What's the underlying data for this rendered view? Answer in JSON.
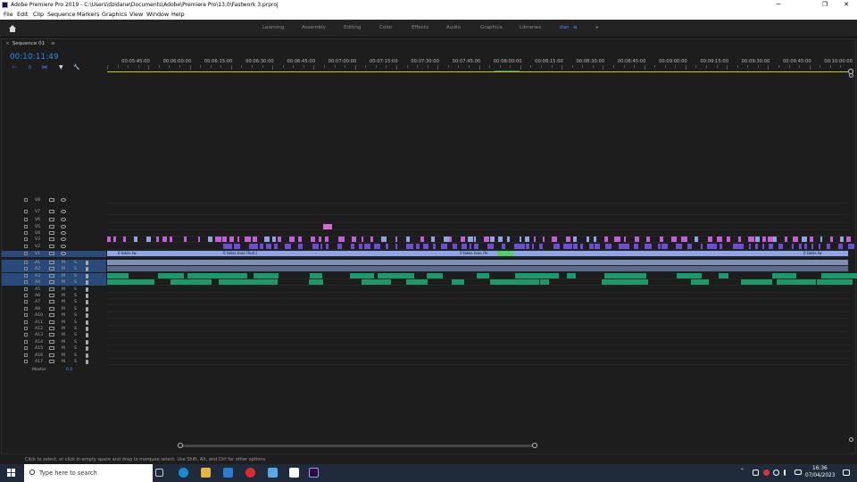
{
  "window": {
    "title": "Adobe Premiere Pro 2019 - C:\\Users\\dzidane\\Documents\\Adobe\\Premiere Pro\\13.0\\Fastwork 3.prproj",
    "minimize": "─",
    "maximize": "❐",
    "close": "✕"
  },
  "menu": [
    "File",
    "Edit",
    "Clip",
    "Sequence",
    "Markers",
    "Graphics",
    "View",
    "Window",
    "Help"
  ],
  "workspaces": {
    "items": [
      "Learning",
      "Assembly",
      "Editing",
      "Color",
      "Effects",
      "Audio",
      "Graphics",
      "Libraries",
      "dan"
    ],
    "active": "dan",
    "more": "»",
    "menu_glyph": "≡"
  },
  "sequence": {
    "tab": "Sequence 01",
    "close": "×",
    "menu": "≡",
    "timecode": "00:10:11:49"
  },
  "tools": [
    "⊢",
    "∩",
    "⋈",
    "▼",
    "🔧"
  ],
  "ruler": {
    "labels": [
      "00:05:45:00",
      "00:06:00:00",
      "00:06:15:00",
      "00:06:30:00",
      "00:06:45:00",
      "00:07:00:00",
      "00:07:15:00",
      "00:07:30:00",
      "00:07:45:00",
      "00:08:00:00",
      "00:08:15:00",
      "00:08:30:00",
      "00:08:45:00",
      "00:09:00:00",
      "00:09:15:00",
      "00:09:30:00",
      "00:09:45:00",
      "00:10:00:00"
    ]
  },
  "video_tracks": [
    "V8",
    "V7",
    "V6",
    "V5",
    "V4",
    "V3",
    "V2",
    "V1"
  ],
  "audio_tracks": [
    "A1",
    "A2",
    "A3",
    "A4",
    "A5",
    "A6",
    "A7",
    "A8",
    "A10",
    "A11",
    "A12",
    "A13",
    "A14",
    "A15",
    "A16",
    "A17"
  ],
  "master": {
    "label": "Master",
    "value": "0.0"
  },
  "clip_labels": {
    "v1": "0 takes tw",
    "v1b": "0 takes tooo (feat.)",
    "v1c": "0 takes tooo (fe"
  },
  "status": "Click to select, or click in empty space and drag to marquee select. Use Shift, Alt, and Ctrl for other options.",
  "taskbar": {
    "search_placeholder": "Type here to search",
    "time": "16:36",
    "date": "07/04/2023",
    "tray_up": "⌃"
  },
  "colors": {
    "accent": "#3a8fff",
    "video_clip": "#8ea6e6",
    "audio_clip": "#1a9a6a",
    "magenta": "#c75ddb"
  }
}
